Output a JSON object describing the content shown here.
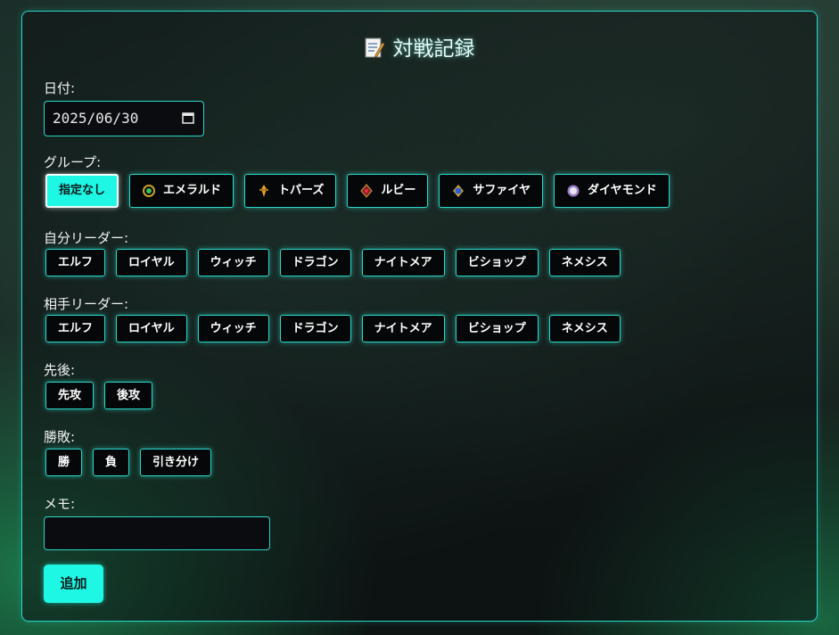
{
  "title": "対戦記録",
  "date": {
    "label": "日付:",
    "value": "2025/06/30"
  },
  "group": {
    "label": "グループ:",
    "options": [
      {
        "label": "指定なし",
        "selected": true,
        "icon": ""
      },
      {
        "label": "エメラルド",
        "selected": false,
        "icon": "emerald-gem-icon"
      },
      {
        "label": "トパーズ",
        "selected": false,
        "icon": "topaz-gem-icon"
      },
      {
        "label": "ルビー",
        "selected": false,
        "icon": "ruby-gem-icon"
      },
      {
        "label": "サファイヤ",
        "selected": false,
        "icon": "sapphire-gem-icon"
      },
      {
        "label": "ダイヤモンド",
        "selected": false,
        "icon": "diamond-gem-icon"
      }
    ]
  },
  "my_leader": {
    "label": "自分リーダー:",
    "options": [
      "エルフ",
      "ロイヤル",
      "ウィッチ",
      "ドラゴン",
      "ナイトメア",
      "ビショップ",
      "ネメシス"
    ]
  },
  "opp_leader": {
    "label": "相手リーダー:",
    "options": [
      "エルフ",
      "ロイヤル",
      "ウィッチ",
      "ドラゴン",
      "ナイトメア",
      "ビショップ",
      "ネメシス"
    ]
  },
  "turn_order": {
    "label": "先後:",
    "options": [
      "先攻",
      "後攻"
    ]
  },
  "result": {
    "label": "勝敗:",
    "options": [
      "勝",
      "負",
      "引き分け"
    ]
  },
  "memo": {
    "label": "メモ:",
    "value": ""
  },
  "add_button": "追加",
  "colors": {
    "accent": "#1ff7e5",
    "border": "#2bd7c7",
    "panel_bg": "#0c1012"
  }
}
